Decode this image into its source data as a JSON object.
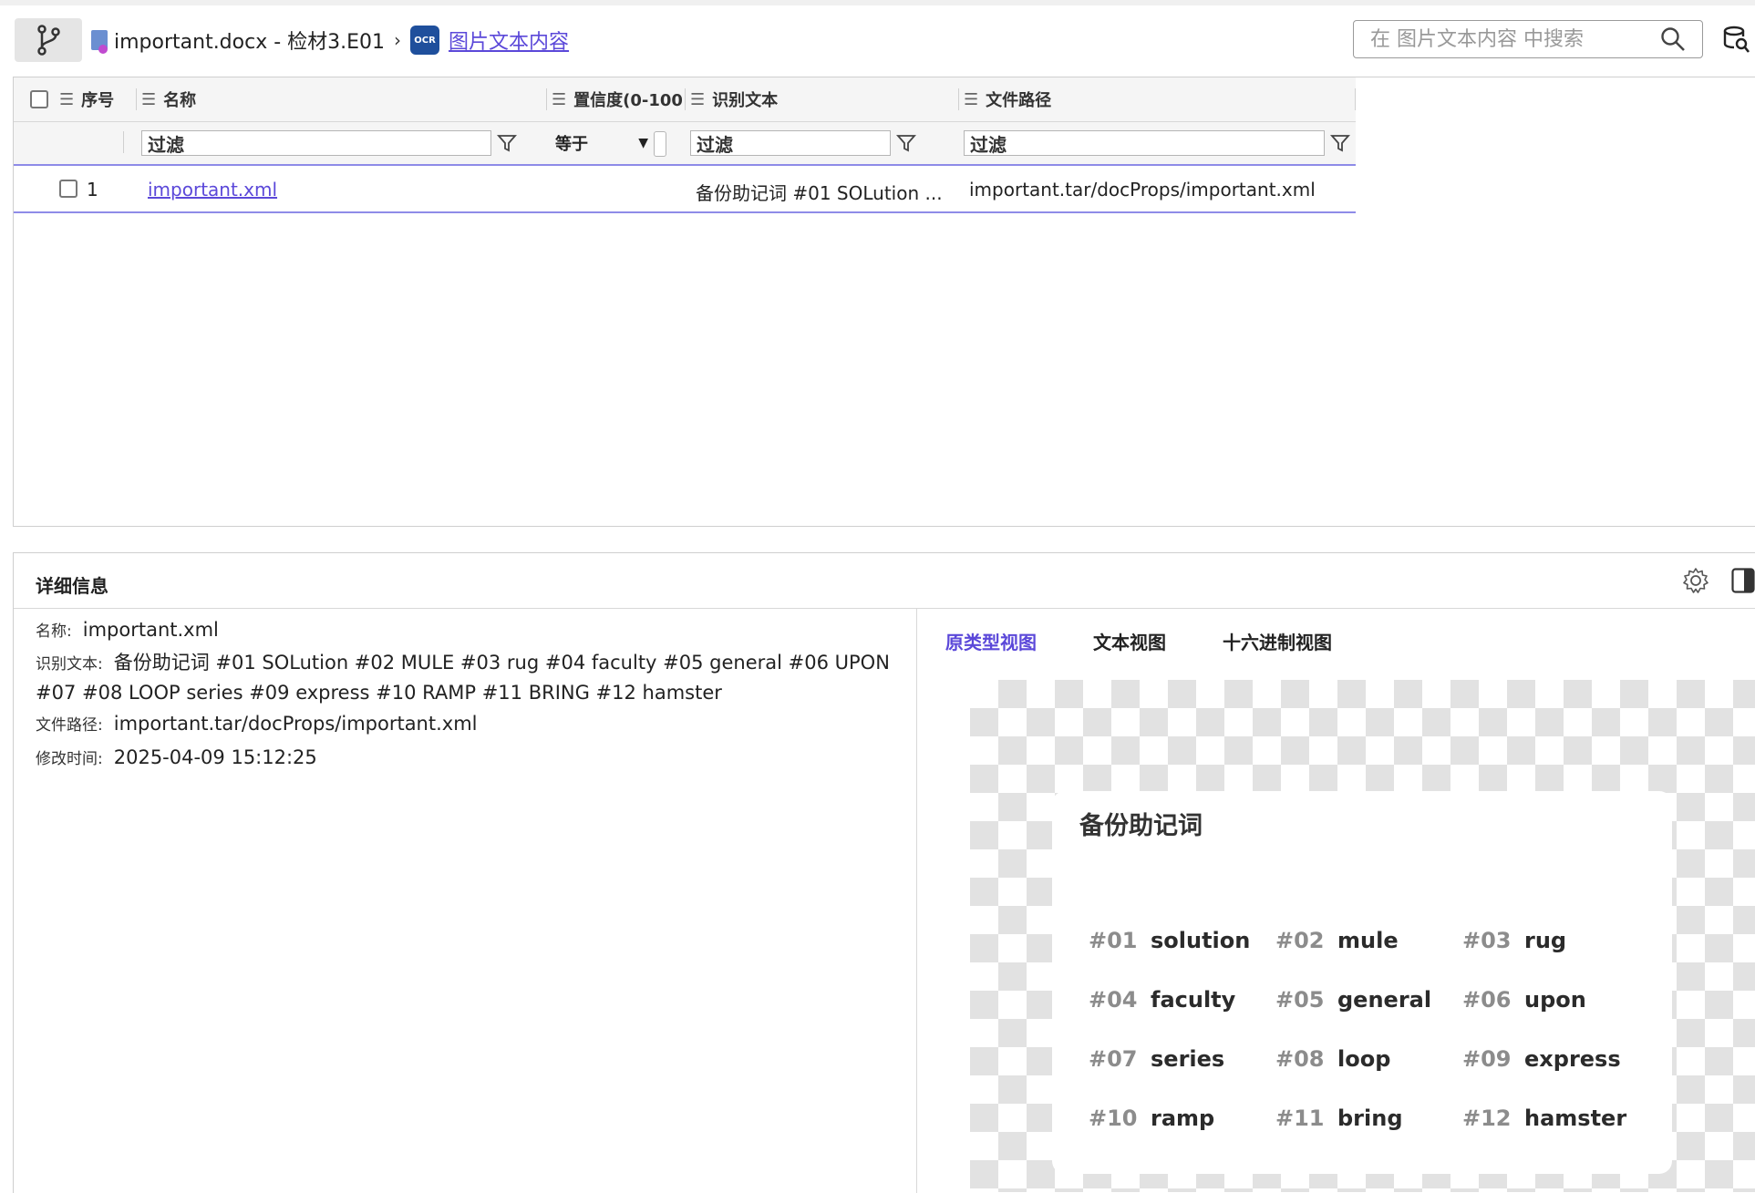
{
  "breadcrumb": {
    "file": "important.docx - 检材3.E01",
    "separator": "›",
    "ocr_badge": "OCR",
    "current": "图片文本内容"
  },
  "search": {
    "placeholder": "在 图片文本内容 中搜索"
  },
  "table": {
    "columns": [
      "序号",
      "名称",
      "置信度(0-100",
      "识别文本",
      "文件路径"
    ],
    "filter_placeholder": "过滤",
    "confidence_operator": "等于",
    "rows": [
      {
        "index": "1",
        "name": "important.xml",
        "text": "备份助记词 #01 SOLution ...",
        "path": "important.tar/docProps/important.xml"
      }
    ]
  },
  "details": {
    "title": "详细信息",
    "fields": [
      {
        "key": "名称:",
        "value": "important.xml"
      },
      {
        "key": "识别文本:",
        "value": "备份助记词 #01 SOLution #02 MULE #03 rug #04 faculty #05 general #06 UPON #07 #08 LOOP series #09 express #10 RAMP #11 BRING #12 hamster"
      },
      {
        "key": "文件路径:",
        "value": "important.tar/docProps/important.xml"
      },
      {
        "key": "修改时间:",
        "value": "2025-04-09 15:12:25"
      }
    ],
    "tabs": [
      "原类型视图",
      "文本视图",
      "十六进制视图"
    ],
    "active_tab": "原类型视图"
  },
  "preview": {
    "title": "备份助记词",
    "words": [
      {
        "num": "#01",
        "word": "solution"
      },
      {
        "num": "#02",
        "word": "mule"
      },
      {
        "num": "#03",
        "word": "rug"
      },
      {
        "num": "#04",
        "word": "faculty"
      },
      {
        "num": "#05",
        "word": "general"
      },
      {
        "num": "#06",
        "word": "upon"
      },
      {
        "num": "#07",
        "word": "series"
      },
      {
        "num": "#08",
        "word": "loop"
      },
      {
        "num": "#09",
        "word": "express"
      },
      {
        "num": "#10",
        "word": "ramp"
      },
      {
        "num": "#11",
        "word": "bring"
      },
      {
        "num": "#12",
        "word": "hamster"
      }
    ]
  },
  "colors": {
    "accent": "#5b48d9",
    "row_border": "#8e8be8",
    "ocr_badge": "#1f4f9c"
  }
}
